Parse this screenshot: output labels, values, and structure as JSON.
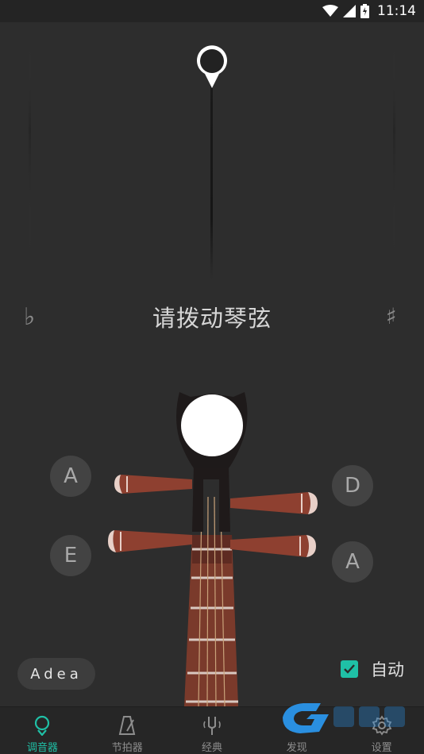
{
  "status_bar": {
    "time": "11:14"
  },
  "tuner": {
    "prompt": "请拨动琴弦",
    "flat_symbol": "♭",
    "sharp_symbol": "♯"
  },
  "strings": {
    "left_top": "A",
    "left_bottom": "E",
    "right_top": "D",
    "right_bottom": "A"
  },
  "tuning_name": "Adea",
  "auto_toggle": {
    "label": "自动",
    "checked": true
  },
  "nav": {
    "items": [
      {
        "label": "调音器",
        "icon": "pin-icon",
        "active": true
      },
      {
        "label": "节拍器",
        "icon": "metronome-icon",
        "active": false
      },
      {
        "label": "经典",
        "icon": "tuning-fork-icon",
        "active": false
      },
      {
        "label": "发现",
        "icon": "discover-icon",
        "active": false
      },
      {
        "label": "设置",
        "icon": "gear-icon",
        "active": false
      }
    ]
  },
  "colors": {
    "accent": "#1fc0a6",
    "background": "#2d2d2d",
    "button": "#434343"
  }
}
